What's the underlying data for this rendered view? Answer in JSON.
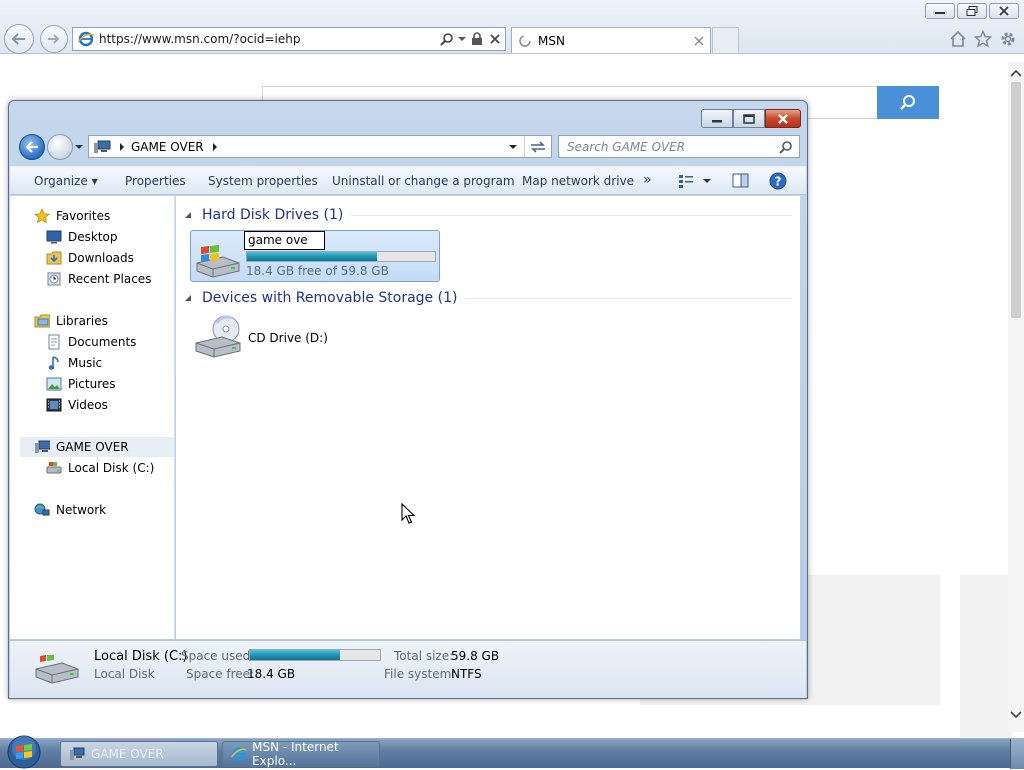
{
  "browser": {
    "url": "https://www.msn.com/?ocid=iehp",
    "tab_title": "MSN"
  },
  "explorer": {
    "breadcrumb": "GAME OVER",
    "search_placeholder": "Search GAME OVER",
    "toolbar": {
      "organize": "Organize",
      "properties": "Properties",
      "system_properties": "System properties",
      "uninstall": "Uninstall or change a program",
      "map_drive": "Map network drive",
      "more": "»"
    },
    "nav": {
      "favorites": "Favorites",
      "desktop": "Desktop",
      "downloads": "Downloads",
      "recent_places": "Recent Places",
      "libraries": "Libraries",
      "documents": "Documents",
      "music": "Music",
      "pictures": "Pictures",
      "videos": "Videos",
      "computer": "GAME OVER",
      "local_disk": "Local Disk (C:)",
      "network": "Network"
    },
    "groups": {
      "hdd_header": "Hard Disk Drives (1)",
      "removable_header": "Devices with Removable Storage (1)"
    },
    "drive_c": {
      "rename_value": "game ove",
      "free_text": "18.4 GB free of 59.8 GB",
      "used_fraction": 0.69
    },
    "drive_d": {
      "label": "CD Drive (D:)"
    },
    "details": {
      "name": "Local Disk (C:)",
      "type": "Local Disk",
      "space_used_label": "Space used:",
      "space_free_label": "Space free:",
      "space_free_value": "18.4 GB",
      "total_size_label": "Total size:",
      "total_size_value": "59.8 GB",
      "filesystem_label": "File system:",
      "filesystem_value": "NTFS",
      "used_fraction": 0.69
    }
  },
  "taskbar": {
    "explorer_label": "GAME OVER",
    "ie_label": "MSN - Internet Explo..."
  },
  "colors": {
    "accent": "#4a90d9",
    "capacity_bar": "#1f8fae"
  }
}
